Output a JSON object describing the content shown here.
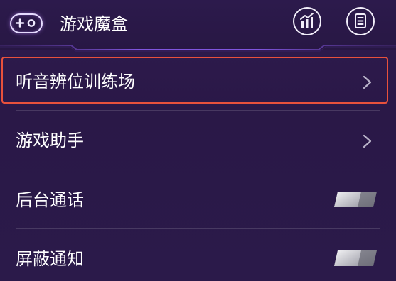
{
  "header": {
    "title": "游戏魔盒",
    "logo_icon": "plus-circle-gamepad-icon",
    "stats_icon": "bar-chart-icon",
    "notes_icon": "document-icon"
  },
  "items": [
    {
      "label": "听音辨位训练场",
      "control": "chevron",
      "highlighted": true
    },
    {
      "label": "游戏助手",
      "control": "chevron",
      "highlighted": false
    },
    {
      "label": "后台通话",
      "control": "toggle",
      "toggle_state": "off"
    },
    {
      "label": "屏蔽通知",
      "control": "toggle",
      "toggle_state": "off"
    }
  ],
  "colors": {
    "background": "#2a1847",
    "highlight_border": "#e8513c",
    "text": "#ffffff",
    "accent_glow": "#a45cff"
  }
}
